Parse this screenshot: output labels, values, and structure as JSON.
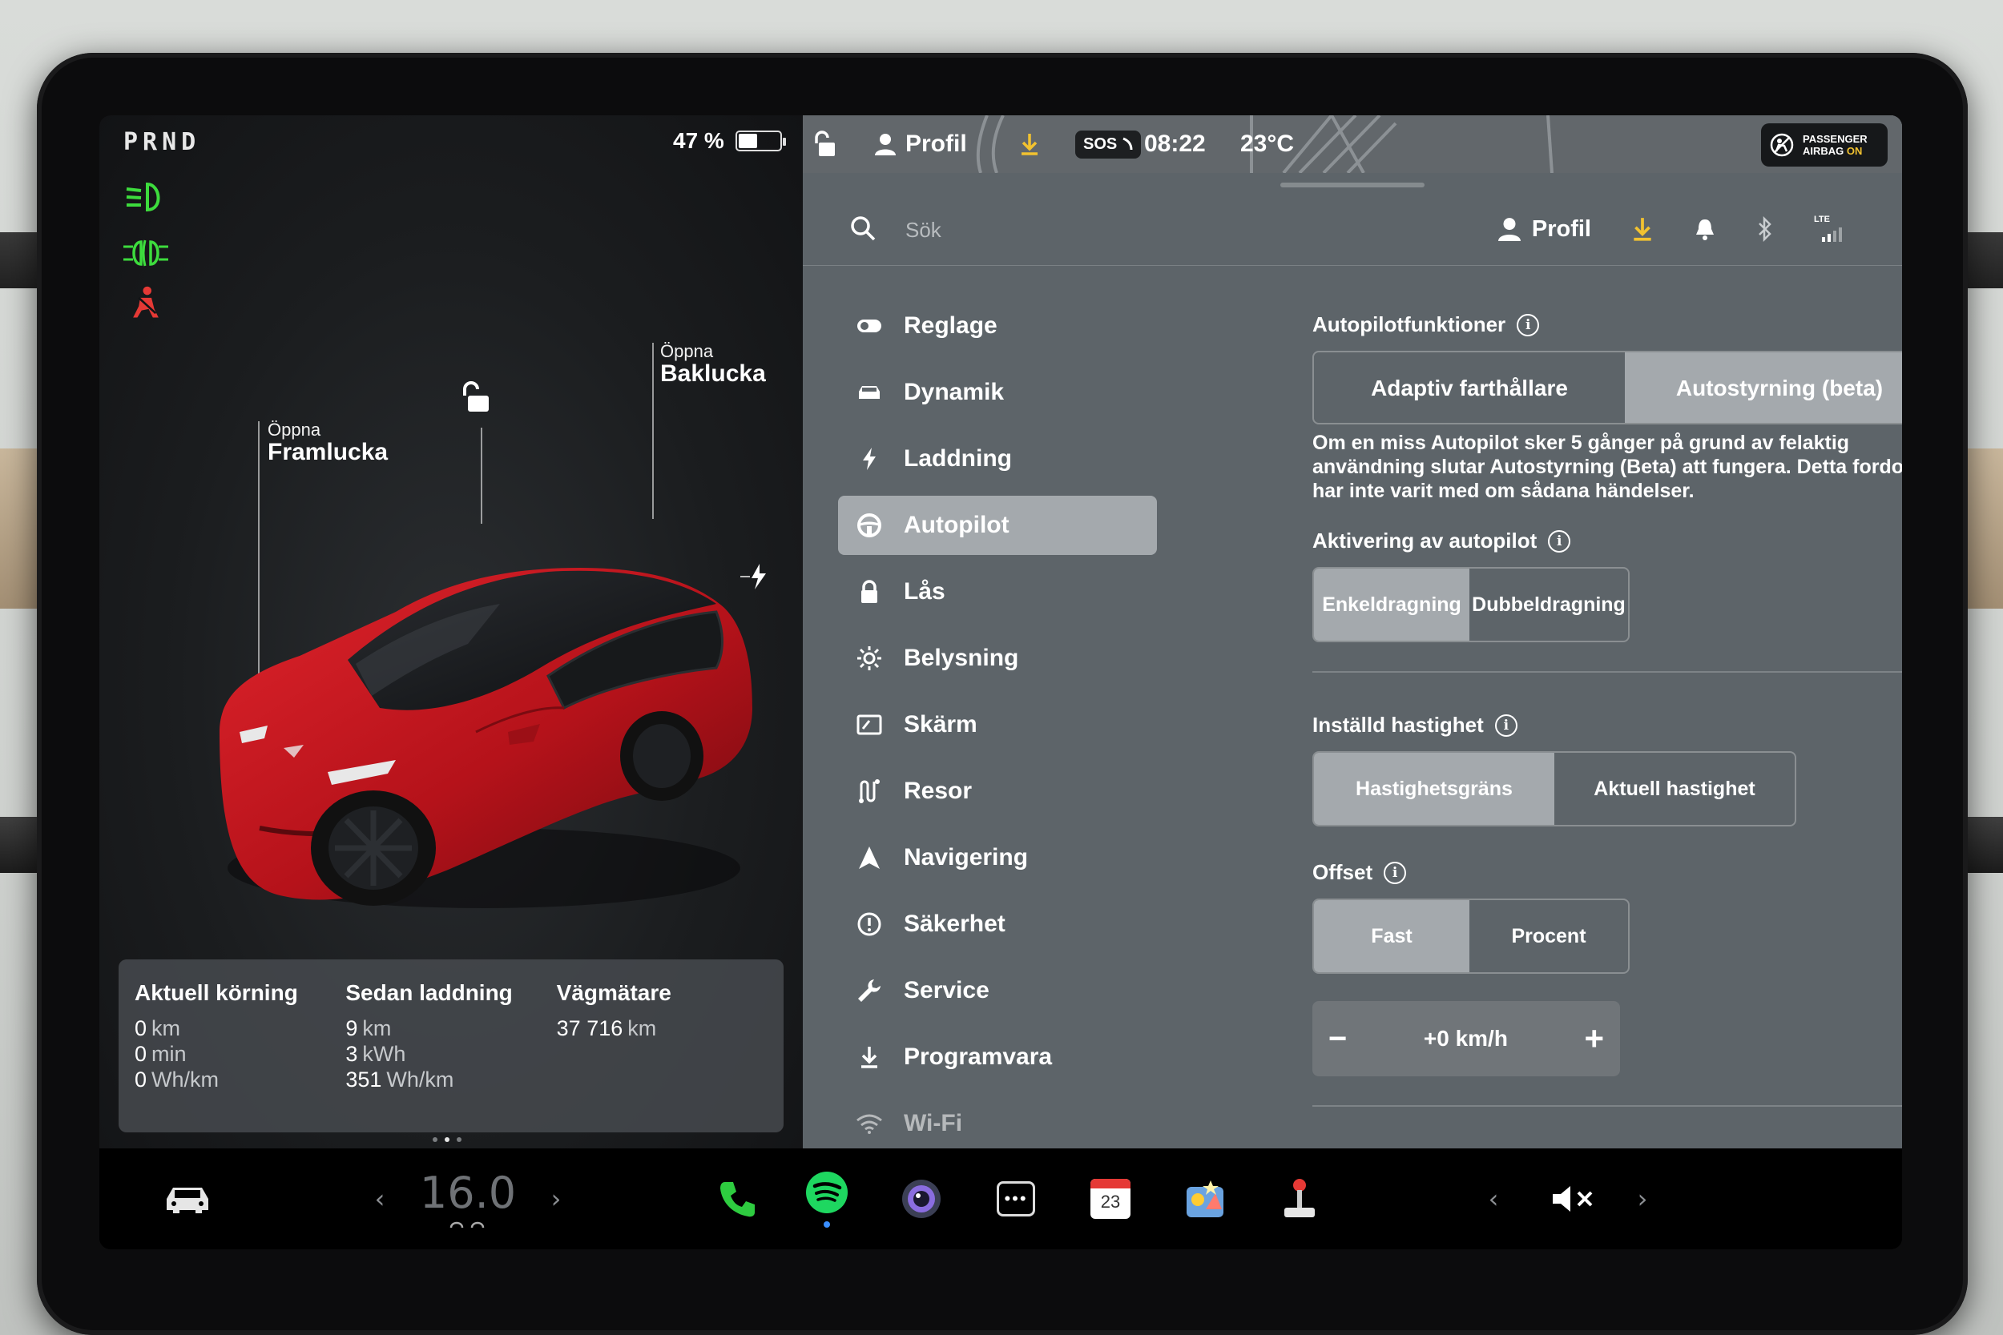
{
  "vehicle": {
    "gear": "PRND",
    "battery_percent": "47 %",
    "battery_level": 0.47,
    "frunk": {
      "small": "Öppna",
      "big": "Framlucka"
    },
    "trunk": {
      "small": "Öppna",
      "big": "Baklucka"
    },
    "stats": [
      {
        "title": "Aktuell körning",
        "rows": [
          {
            "v": "0",
            "u": "km"
          },
          {
            "v": "0",
            "u": "min"
          },
          {
            "v": "0",
            "u": "Wh/km"
          }
        ]
      },
      {
        "title": "Sedan laddning",
        "rows": [
          {
            "v": "9",
            "u": "km"
          },
          {
            "v": "3",
            "u": "kWh"
          },
          {
            "v": "351",
            "u": "Wh/km"
          }
        ]
      },
      {
        "title": "Vägmätare",
        "rows": [
          {
            "v": "37 716",
            "u": "km"
          }
        ]
      }
    ]
  },
  "topbar": {
    "profile": "Profil",
    "sos": "SOS",
    "time": "08:22",
    "temperature": "23°C",
    "airbag_line1": "PASSENGER",
    "airbag_line2": "AIRBAG",
    "airbag_state": "ON"
  },
  "search": {
    "placeholder": "Sök",
    "profile": "Profil",
    "lte": "LTE"
  },
  "menu": [
    {
      "label": "Reglage",
      "icon": "toggle-icon"
    },
    {
      "label": "Dynamik",
      "icon": "car-icon"
    },
    {
      "label": "Laddning",
      "icon": "bolt-icon"
    },
    {
      "label": "Autopilot",
      "icon": "steering-wheel-icon",
      "active": true
    },
    {
      "label": "Lås",
      "icon": "lock-icon"
    },
    {
      "label": "Belysning",
      "icon": "sun-icon"
    },
    {
      "label": "Skärm",
      "icon": "display-icon"
    },
    {
      "label": "Resor",
      "icon": "trips-icon"
    },
    {
      "label": "Navigering",
      "icon": "navigation-icon"
    },
    {
      "label": "Säkerhet",
      "icon": "safety-icon"
    },
    {
      "label": "Service",
      "icon": "wrench-icon"
    },
    {
      "label": "Programvara",
      "icon": "download-icon"
    },
    {
      "label": "Wi-Fi",
      "icon": "wifi-icon"
    }
  ],
  "autopilot": {
    "features_title": "Autopilotfunktioner",
    "features": [
      "Adaptiv farthållare",
      "Autostyrning (beta)"
    ],
    "features_selected": 1,
    "description": "Om en miss Autopilot sker 5 gånger på grund av felaktig användning slutar Autostyrning (Beta) att fungera. Detta fordon har inte varit med om sådana händelser.",
    "activation_title": "Aktivering av autopilot",
    "activation": [
      "Enkeldragning",
      "Dubbeldragning"
    ],
    "activation_selected": 0,
    "speed_title": "Inställd hastighet",
    "speed": [
      "Hastighetsgräns",
      "Aktuell hastighet"
    ],
    "speed_selected": 0,
    "offset_title": "Offset",
    "offset": [
      "Fast",
      "Procent"
    ],
    "offset_selected": 0,
    "offset_value": "+0 km/h",
    "minus": "−",
    "plus": "+"
  },
  "dock": {
    "temperature": "16.0",
    "left_arrow": "‹",
    "right_arrow": "›",
    "calendar_day": "23",
    "more": "•••"
  },
  "colors": {
    "active_segment": "#a4a9ad",
    "headlight_green": "#3ddc3d",
    "seatbelt_red": "#e53935",
    "download_yellow": "#f2c230",
    "spotify_green": "#1ed760",
    "phone_green": "#2ecc40"
  }
}
